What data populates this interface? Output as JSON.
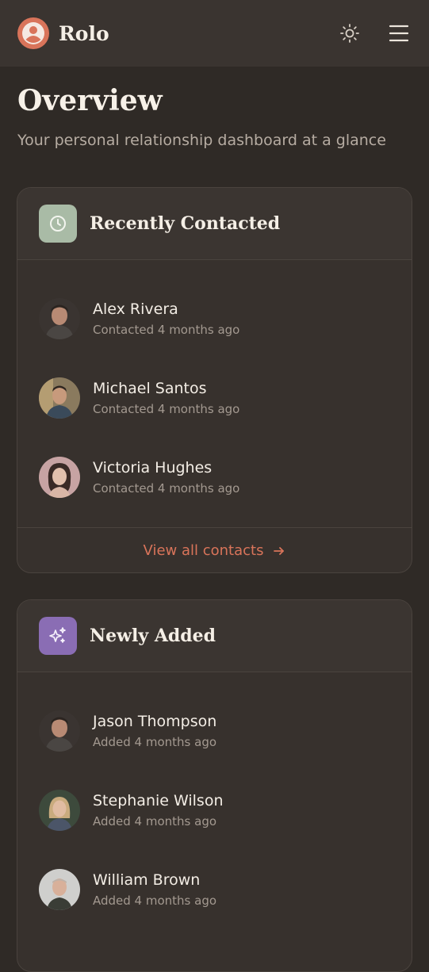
{
  "app": {
    "name": "Rolo"
  },
  "header": {
    "logo_icon": "user-circle-icon",
    "theme_icon": "sun-icon",
    "menu_icon": "hamburger-menu-icon"
  },
  "page": {
    "title": "Overview",
    "subtitle": "Your personal relationship dashboard at a glance"
  },
  "recently_contacted": {
    "title": "Recently Contacted",
    "icon": "clock-icon",
    "icon_bg": "#a9bba6",
    "contacts": [
      {
        "name": "Alex Rivera",
        "meta": "Contacted 4 months ago"
      },
      {
        "name": "Michael Santos",
        "meta": "Contacted 4 months ago"
      },
      {
        "name": "Victoria Hughes",
        "meta": "Contacted 4 months ago"
      }
    ],
    "footer_link": "View all contacts"
  },
  "newly_added": {
    "title": "Newly Added",
    "icon": "sparkles-icon",
    "icon_bg": "#8a6db4",
    "contacts": [
      {
        "name": "Jason Thompson",
        "meta": "Added 4 months ago"
      },
      {
        "name": "Stephanie Wilson",
        "meta": "Added 4 months ago"
      },
      {
        "name": "William Brown",
        "meta": "Added 4 months ago"
      }
    ]
  },
  "colors": {
    "accent": "#d9745a",
    "background": "#2f2a26",
    "card": "#37312d"
  }
}
